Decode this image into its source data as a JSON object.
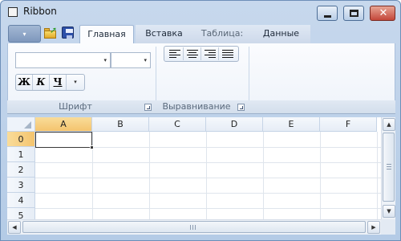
{
  "window": {
    "title": "Ribbon",
    "close_glyph": "✕"
  },
  "quick_access": {
    "menu_caret": "▾",
    "open_icon": "folder-open-icon",
    "save_icon": "save-icon"
  },
  "tabs": [
    {
      "label": "Главная"
    },
    {
      "label": "Вставка"
    },
    {
      "label": "Таблица:"
    },
    {
      "label": "Данные"
    }
  ],
  "ribbon": {
    "font_group": {
      "label": "Шрифт",
      "font_value": "",
      "size_value": "",
      "bold": "Ж",
      "italic": "К",
      "underline": "Ч",
      "more": "▾",
      "combo_caret": "▾"
    },
    "align_group": {
      "label": "Выравнивание"
    }
  },
  "grid": {
    "columns": [
      "A",
      "B",
      "C",
      "D",
      "E",
      "F"
    ],
    "rows": [
      "0",
      "1",
      "2",
      "3",
      "4",
      "5"
    ],
    "selected_cell": "A0"
  },
  "scroll": {
    "up": "▲",
    "down": "▼",
    "left": "◀",
    "right": "▶"
  },
  "colors": {
    "accent": "#f4c46e",
    "frame": "#b4cbe6"
  }
}
